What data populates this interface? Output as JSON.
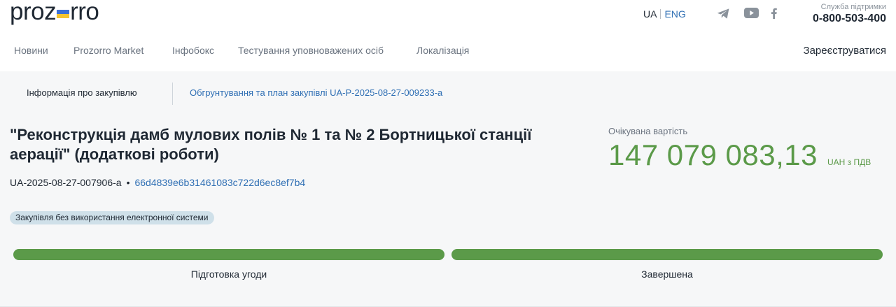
{
  "header": {
    "logo": {
      "left": "proz",
      "right": "rro"
    },
    "languages": {
      "current": "UA",
      "other": "ENG"
    },
    "social": [
      "telegram-icon",
      "youtube-icon",
      "facebook-icon"
    ],
    "support": {
      "label": "Служба підтримки",
      "phone": "0-800-503-400"
    }
  },
  "nav": {
    "items": [
      "Новини",
      "Prozorro Market",
      "Інфобокс",
      "Тестування уповноважених осіб",
      "Локалізація"
    ],
    "register": "Зареєструватися"
  },
  "tabs": {
    "active": "Інформація про закупівлю",
    "plan_link": "Обгрунтування та план закупівлі UA-P-2025-08-27-009233-a"
  },
  "tender": {
    "title": "\"Реконструкція дамб мулових полів № 1 та № 2 Бортницької станції аерації\" (додаткові роботи)",
    "id": "UA-2025-08-27-007906-a",
    "separator": "•",
    "hash": "66d4839e6b31461083c722d6ec8ef7b4",
    "badge": "Закупівля без використання електронної системи"
  },
  "expected_value": {
    "label": "Очікувана вартість",
    "amount": "147 079 083,13",
    "currency": "UAH з ПДВ"
  },
  "stages": [
    {
      "label": "Підготовка угоди",
      "progress": 1.0
    },
    {
      "label": "Завершена",
      "progress": 1.0
    }
  ],
  "colors": {
    "accent_green": "#5b9a49",
    "link_blue": "#2f6fb4",
    "badge_bg": "#cfe0e9",
    "panel_bg": "#f6f7f8"
  }
}
